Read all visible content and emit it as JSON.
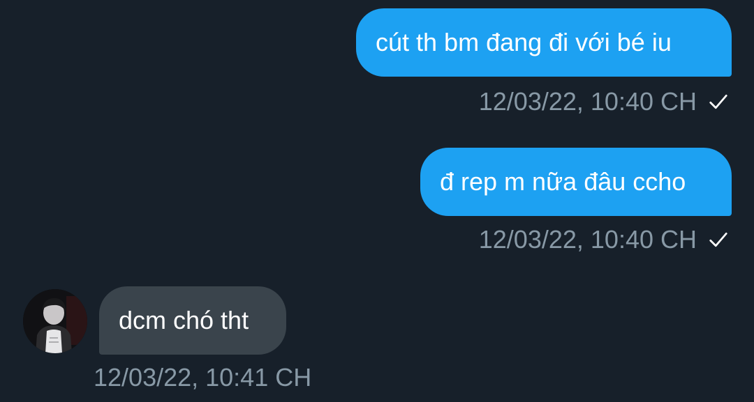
{
  "messages": [
    {
      "direction": "outgoing",
      "text": "cút th bm đang đi với bé iu",
      "timestamp": "12/03/22, 10:40 CH",
      "status_icon": "checkmark-icon"
    },
    {
      "direction": "outgoing",
      "text": "đ rep m nữa đâu ccho",
      "timestamp": "12/03/22, 10:40 CH",
      "status_icon": "checkmark-icon"
    },
    {
      "direction": "incoming",
      "text": "dcm chó tht",
      "timestamp": "12/03/22, 10:41 CH",
      "avatar_icon": "user-avatar"
    }
  ],
  "colors": {
    "background": "#17202a",
    "outgoing_bubble": "#1da1f2",
    "incoming_bubble": "#3a444c",
    "timestamp_text": "#8899a6",
    "message_text": "#ffffff"
  }
}
